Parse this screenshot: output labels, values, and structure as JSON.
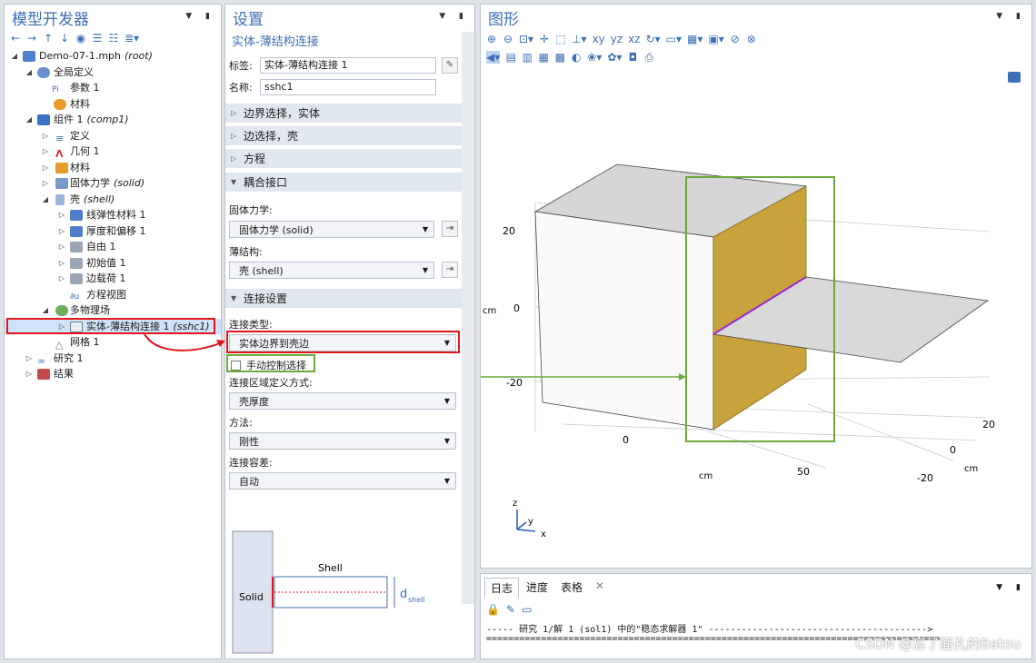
{
  "tree_panel": {
    "title": "模型开发器",
    "items": [
      {
        "label": "Demo-07-1.mph",
        "tag": "(root)"
      },
      {
        "label": "全局定义",
        "tag": ""
      },
      {
        "label": "参数 1",
        "tag": ""
      },
      {
        "label": "材料",
        "tag": ""
      },
      {
        "label": "组件 1",
        "tag": "(comp1)"
      },
      {
        "label": "定义",
        "tag": ""
      },
      {
        "label": "几何 1",
        "tag": ""
      },
      {
        "label": "材料",
        "tag": ""
      },
      {
        "label": "固体力学",
        "tag": "(solid)"
      },
      {
        "label": "壳",
        "tag": "(shell)"
      },
      {
        "label": "线弹性材料 1",
        "tag": ""
      },
      {
        "label": "厚度和偏移 1",
        "tag": ""
      },
      {
        "label": "自由 1",
        "tag": ""
      },
      {
        "label": "初始值 1",
        "tag": ""
      },
      {
        "label": "边载荷 1",
        "tag": ""
      },
      {
        "label": "方程视图",
        "tag": ""
      },
      {
        "label": "多物理场",
        "tag": ""
      },
      {
        "label": "实体-薄结构连接 1",
        "tag": "(sshc1)"
      },
      {
        "label": "网格 1",
        "tag": ""
      },
      {
        "label": "研究 1",
        "tag": ""
      },
      {
        "label": "结果",
        "tag": ""
      }
    ]
  },
  "settings_panel": {
    "title": "设置",
    "subtitle": "实体-薄结构连接",
    "label_field": {
      "label": "标签:",
      "value": "实体-薄结构连接 1"
    },
    "name_field": {
      "label": "名称:",
      "value": "sshc1"
    },
    "sections": {
      "boundary_solid": "边界选择，实体",
      "edge_shell": "边选择，壳",
      "equation": "方程",
      "coupled_interface": "耦合接口",
      "connection_settings": "连接设置"
    },
    "solid_mechanics_label": "固体力学:",
    "solid_mechanics_value": "固体力学 (solid)",
    "thin_structure_label": "薄结构:",
    "thin_structure_value": "壳 (shell)",
    "connection_type_label": "连接类型:",
    "connection_type_value": "实体边界到壳边",
    "manual_checkbox": "手动控制选择",
    "region_label": "连接区域定义方式:",
    "region_value": "壳厚度",
    "method_label": "方法:",
    "method_value": "刚性",
    "tolerance_label": "连接容差:",
    "tolerance_value": "自动",
    "diagram": {
      "solid": "Solid",
      "shell": "Shell",
      "d": "d",
      "d_sub": "shell"
    }
  },
  "graphics_panel": {
    "title": "图形",
    "axis_labels": {
      "z_top": "20",
      "z_mid": "0",
      "z_bot": "-20",
      "z_unit": "cm",
      "x_0": "0",
      "x_50": "50",
      "x_unit": "cm",
      "y_20": "20",
      "y_0": "0",
      "y_m20": "-20",
      "y_unit": "cm"
    },
    "triad": {
      "z": "z",
      "y": "y",
      "x": "x"
    }
  },
  "log_panel": {
    "tabs": [
      "日志",
      "进度",
      "表格"
    ],
    "line1": "----- 研究 1/解 1 (sol1) 中的\"稳态求解器 1\" ---------------------------------------->",
    "line2": "==================================================================================="
  },
  "watermark": "CSDN @忘了面孔的Batou",
  "colors": {
    "accent": "#3d6fb6",
    "highlight_red": "#e0161b",
    "highlight_green": "#6aaa3a",
    "shell_face": "#c8a23a"
  }
}
